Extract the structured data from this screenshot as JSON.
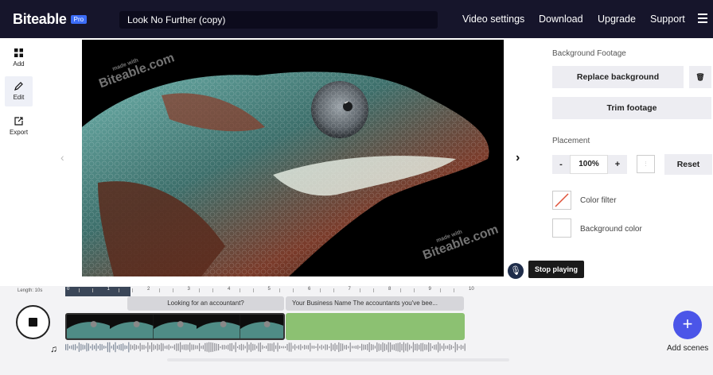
{
  "header": {
    "logo": "Biteable",
    "badge": "Pro",
    "project_title": "Look No Further (copy)",
    "nav": [
      "Video settings",
      "Download",
      "Upgrade",
      "Support"
    ]
  },
  "left_tools": [
    {
      "label": "Add",
      "icon": "grid-icon"
    },
    {
      "label": "Edit",
      "icon": "pencil-icon"
    },
    {
      "label": "Export",
      "icon": "export-icon"
    }
  ],
  "preview": {
    "watermark": "Biteable.com",
    "watermark_small": "made with"
  },
  "controls": {
    "tooltip": "Stop playing"
  },
  "right_panel": {
    "background_heading": "Background Footage",
    "replace_label": "Replace background",
    "trim_label": "Trim footage",
    "placement_heading": "Placement",
    "minus": "-",
    "zoom": "100%",
    "plus": "+",
    "reset_label": "Reset",
    "color_filter_label": "Color filter",
    "background_color_label": "Background color"
  },
  "timeline": {
    "length": "Length: 10s",
    "ticks": [
      "0",
      "1",
      "2",
      "3",
      "4",
      "5",
      "6",
      "7",
      "8",
      "9",
      "10"
    ],
    "text_tracks": [
      "Looking for an accountant?",
      "Your Business Name The accountants you've bee..."
    ],
    "add_scenes_label": "Add scenes",
    "playback_progress": 0.16
  },
  "colors": {
    "topbar": "#16152b",
    "pro_badge": "#3b6cf6",
    "add_button": "#4b55e8",
    "scene_green": "#8cc172",
    "text_track": "#d6d6da"
  }
}
